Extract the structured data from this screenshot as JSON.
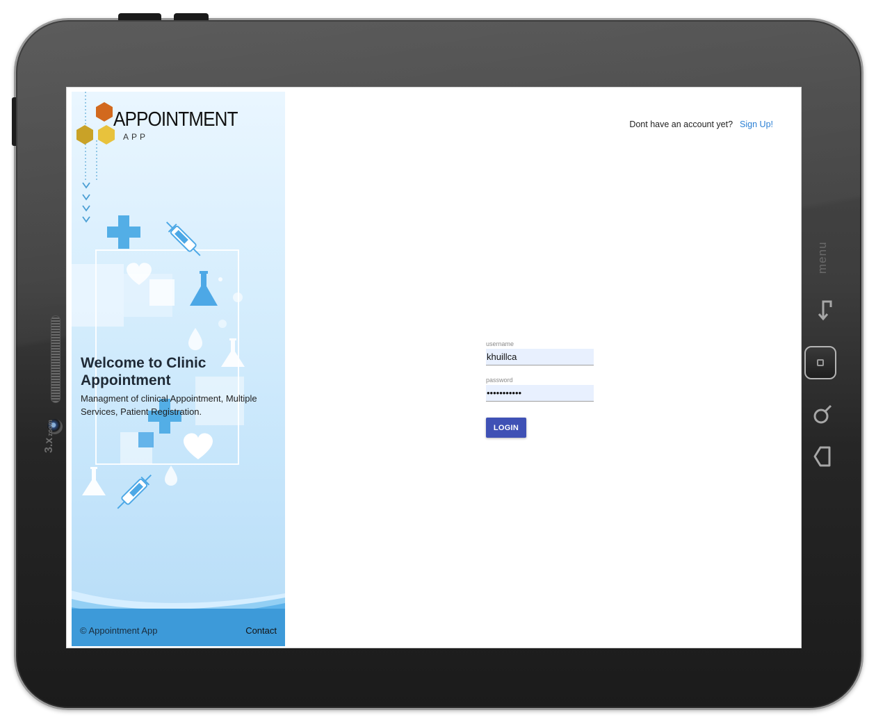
{
  "device": {
    "zoom_label": {
      "main": "3.x",
      "sub": "zoom"
    },
    "menu_label": "menu",
    "hardware_buttons": [
      "back-icon",
      "home-icon",
      "search-icon",
      "return-icon"
    ]
  },
  "sidebar": {
    "logo_title": "APPOINTMENT",
    "logo_subtitle": "APP",
    "welcome_title": "Welcome to Clinic Appointment",
    "welcome_description": "Managment of clinical Appointment, Multiple Services, Patient Registration.",
    "footer": {
      "copyright": "© Appointment App",
      "contact": "Contact"
    }
  },
  "header": {
    "signup_prompt": "Dont have an account yet?",
    "signup_link": "Sign Up!"
  },
  "login_form": {
    "username_label": "username",
    "username_value": "khuillca",
    "password_label": "password",
    "password_value": "•••••••••••",
    "login_button": "LOGIN"
  },
  "colors": {
    "primary_button": "#3f51b5",
    "link": "#2a7fd4",
    "footer_bar": "#3d9ad9",
    "logo_orange": "#d2691e",
    "logo_gold": "#c9a227",
    "logo_yellow": "#e8c23c"
  }
}
